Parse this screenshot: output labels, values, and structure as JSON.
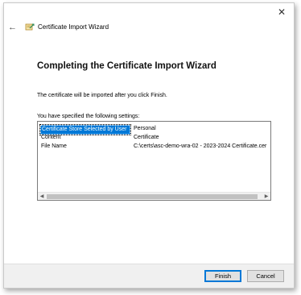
{
  "window": {
    "close_glyph": "✕"
  },
  "titlebar": {
    "back_glyph": "←",
    "title": "Certificate Import Wizard",
    "icon": "certificate-wizard-icon"
  },
  "main": {
    "heading": "Completing the Certificate Import Wizard",
    "info": "The certificate will be imported after you click Finish.",
    "settings_caption": "You have specified the following settings:",
    "settings": [
      {
        "key": "Certificate Store Selected by User",
        "value": "Personal"
      },
      {
        "key": "Content",
        "value": "Certificate"
      },
      {
        "key": "File Name",
        "value": "C:\\certs\\asc-demo-wra-02 - 2023-2024 Certificate.cer"
      }
    ]
  },
  "buttons": {
    "finish": "Finish",
    "cancel": "Cancel"
  },
  "colors": {
    "selection": "#0078d7",
    "footer": "#f0f0f0"
  }
}
